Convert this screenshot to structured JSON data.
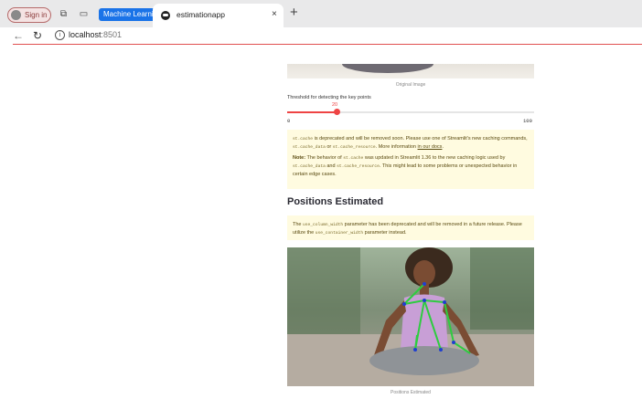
{
  "browser": {
    "signin_label": "Sign in",
    "tab_group": "Machine Learning",
    "tab_title": "estimationapp",
    "close_glyph": "×",
    "newtab_glyph": "+",
    "url_host": "localhost",
    "url_port": ":8501"
  },
  "app": {
    "top_caption": "Original Image",
    "slider": {
      "label": "Threshold for detecting the key points",
      "value": 20,
      "min": 0,
      "max": 100,
      "value_text": "20",
      "min_text": "0",
      "max_text": "100",
      "accent": "#ee4444"
    },
    "cache_warning": {
      "code1": "st.cache",
      "text1": " is deprecated and will be removed soon. Please use one of Streamlit's new caching commands, ",
      "code2": "st.cache_data",
      "text2": " or ",
      "code3": "st.cache_resource",
      "text3": ". More information ",
      "link": "in our docs",
      "text4": ".",
      "note_label": "Note:",
      "note1": " The behavior of ",
      "note_code1": "st.cache",
      "note2": " was updated in Streamlit 1.36 to the new caching logic used by ",
      "note_code2": "st.cache_data",
      "note3": " and ",
      "note_code3": "st.cache_resource",
      "note4": ". This might lead to some problems or unexpected behavior in certain edge cases."
    },
    "section_title": "Positions Estimated",
    "column_warning": {
      "text1": "The ",
      "code1": "use_column_width",
      "text2": " parameter has been deprecated and will be removed in a future release. Please utilize the ",
      "code2": "use_container_width",
      "text3": " parameter instead."
    },
    "bottom_caption": "Positions Estimated"
  }
}
